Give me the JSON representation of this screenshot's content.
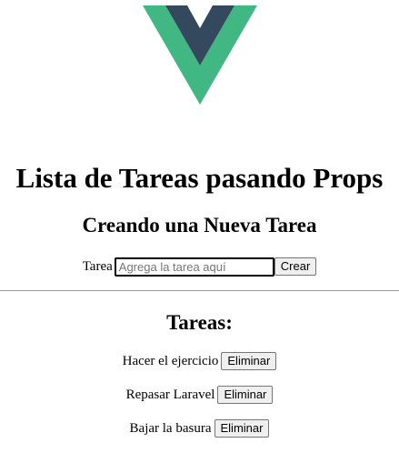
{
  "colors": {
    "logo_outer": "#41b883",
    "logo_inner": "#34495e",
    "divider": "#9a9a9a"
  },
  "header": {
    "logo_icon": "vue-logo-icon",
    "title": "Lista de Tareas pasando Props"
  },
  "form": {
    "heading": "Creando una Nueva Tarea",
    "label": "Tarea",
    "input_value": "",
    "input_placeholder": "Agrega la tarea aquí",
    "submit_label": "Crear"
  },
  "tasks_section": {
    "heading": "Tareas:",
    "items": [
      {
        "text": "Hacer el ejercicio",
        "delete_label": "Eliminar"
      },
      {
        "text": "Repasar Laravel",
        "delete_label": "Eliminar"
      },
      {
        "text": "Bajar la basura",
        "delete_label": "Eliminar"
      }
    ]
  }
}
